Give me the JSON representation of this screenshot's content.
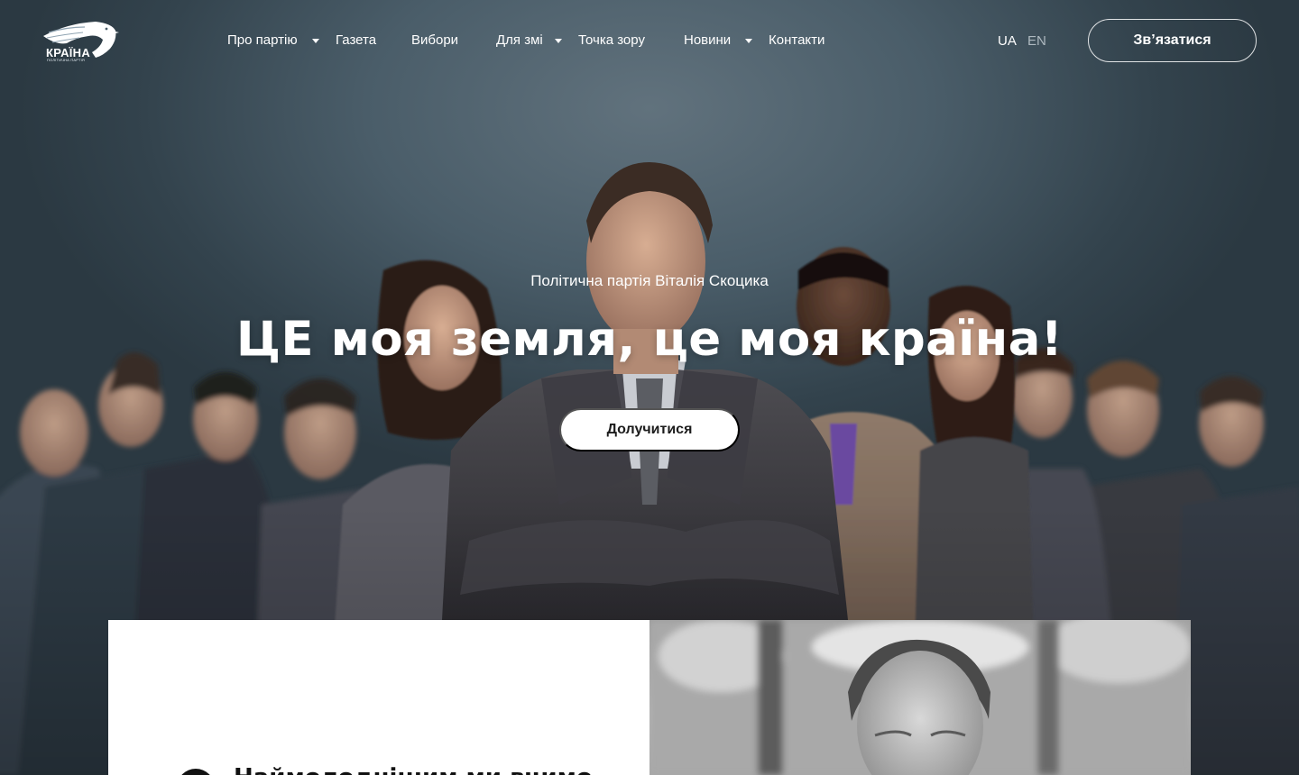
{
  "brand": {
    "logo_word": "КРАЇНА",
    "logo_sub": "ПОЛІТИЧНА ПАРТІЯ"
  },
  "nav": {
    "items": [
      {
        "label": "Про партію",
        "has_dropdown": true
      },
      {
        "label": "Газета",
        "has_dropdown": false
      },
      {
        "label": "Вибори",
        "has_dropdown": false
      },
      {
        "label": "Для змі",
        "has_dropdown": true
      },
      {
        "label": "Точка зору",
        "has_dropdown": false
      },
      {
        "label": "Новини",
        "has_dropdown": true
      },
      {
        "label": "Контакти",
        "has_dropdown": false
      }
    ]
  },
  "lang": {
    "ua": "UA",
    "en": "EN",
    "active": "UA"
  },
  "header": {
    "contact_label": "Зв’язатися"
  },
  "hero": {
    "subtitle": "Політична партія Віталія Скоцика",
    "title": "ЦЕ моя земля, це моя країна!",
    "cta_label": "Долучитися"
  },
  "card": {
    "heading": "Наймолоднішим ми вчимо"
  },
  "colors": {
    "hero_bg": "#4a5d69",
    "text": "#ffffff",
    "lang_inactive": "#aeb9c0",
    "cta_bg": "#ffffff",
    "cta_text": "#1c1c1c"
  }
}
